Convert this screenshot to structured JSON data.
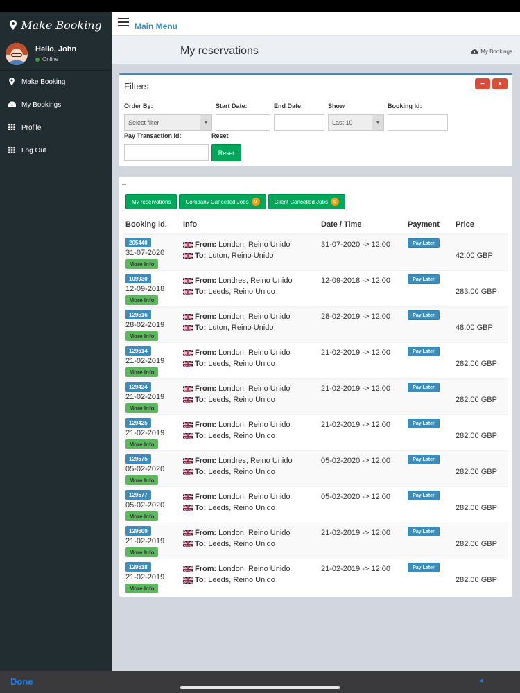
{
  "app": {
    "brand": "Make Booking",
    "user_greeting": "Hello, John",
    "user_status": "Online",
    "menu_title": "Main Menu"
  },
  "sidebar": {
    "items": [
      {
        "label": "Make Booking",
        "icon": "map-marker-icon"
      },
      {
        "label": "My Bookings",
        "icon": "dashboard-icon"
      },
      {
        "label": "Profile",
        "icon": "grid-icon"
      },
      {
        "label": "Log Out",
        "icon": "grid-icon"
      }
    ]
  },
  "page": {
    "title": "My reservations",
    "breadcrumb": "My Bookings"
  },
  "filters": {
    "title": "Filters",
    "order_by_label": "Order By:",
    "order_by_value": "Select filter",
    "start_date_label": "Start Date:",
    "end_date_label": "End Date:",
    "show_label": "Show",
    "show_value": "Last 10",
    "booking_id_label": "Booking Id:",
    "pay_transaction_label": "Pay Transaction Id:",
    "reset_label": "Reset",
    "reset_button": "Reset",
    "minimize_symbol": "−",
    "close_symbol": "×"
  },
  "reservations": {
    "dash": "--",
    "tabs": [
      {
        "label": "My reservations"
      },
      {
        "label": "Company Cancelled Jobs",
        "count": "0"
      },
      {
        "label": "Client Cancelled Jobs",
        "count": "0"
      }
    ],
    "columns": [
      "Booking Id.",
      "Info",
      "Date / Time",
      "Payment",
      "Price"
    ],
    "from_label": "From:",
    "to_label": "To:",
    "more_info_label": "More Info",
    "pay_later_label": "Pay Later",
    "rows": [
      {
        "id": "205440",
        "date": "31-07-2020",
        "from": "London, Reino Unido",
        "to": "Luton, Reino Unido",
        "datetime": "31-07-2020 -> 12:00",
        "price": "42.00 GBP"
      },
      {
        "id": "109930",
        "date": "12-09-2018",
        "from": "Londres, Reino Unido",
        "to": "Leeds, Reino Unido",
        "datetime": "12-09-2018 -> 12:00",
        "price": "283.00 GBP"
      },
      {
        "id": "129516",
        "date": "28-02-2019",
        "from": "London, Reino Unido",
        "to": "Luton, Reino Unido",
        "datetime": "28-02-2019 -> 12:00",
        "price": "48.00 GBP"
      },
      {
        "id": "129614",
        "date": "21-02-2019",
        "from": "London, Reino Unido",
        "to": "Leeds, Reino Unido",
        "datetime": "21-02-2019 -> 12:00",
        "price": "282.00 GBP"
      },
      {
        "id": "129424",
        "date": "21-02-2019",
        "from": "London, Reino Unido",
        "to": "Leeds, Reino Unido",
        "datetime": "21-02-2019 -> 12:00",
        "price": "282.00 GBP"
      },
      {
        "id": "129425",
        "date": "21-02-2019",
        "from": "London, Reino Unido",
        "to": "Leeds, Reino Unido",
        "datetime": "21-02-2019 -> 12:00",
        "price": "282.00 GBP"
      },
      {
        "id": "129575",
        "date": "05-02-2020",
        "from": "Londres, Reino Unido",
        "to": "Leeds, Reino Unido",
        "datetime": "05-02-2020 -> 12:00",
        "price": "282.00 GBP"
      },
      {
        "id": "129577",
        "date": "05-02-2020",
        "from": "London, Reino Unido",
        "to": "Leeds, Reino Unido",
        "datetime": "05-02-2020 -> 12:00",
        "price": "282.00 GBP"
      },
      {
        "id": "129609",
        "date": "21-02-2019",
        "from": "London, Reino Unido",
        "to": "Leeds, Reino Unido",
        "datetime": "21-02-2019 -> 12:00",
        "price": "282.00 GBP"
      },
      {
        "id": "129618",
        "date": "21-02-2019",
        "from": "London, Reino Unido",
        "to": "Leeds, Reino Unido",
        "datetime": "21-02-2019 -> 12:00",
        "price": "282.00 GBP"
      }
    ]
  },
  "bottom": {
    "done_label": "Done"
  },
  "colors": {
    "sidebar": "#222d32",
    "primary": "#3c8dbc",
    "success": "#00a65a",
    "danger": "#dd4b39",
    "warning": "#f39c12"
  }
}
